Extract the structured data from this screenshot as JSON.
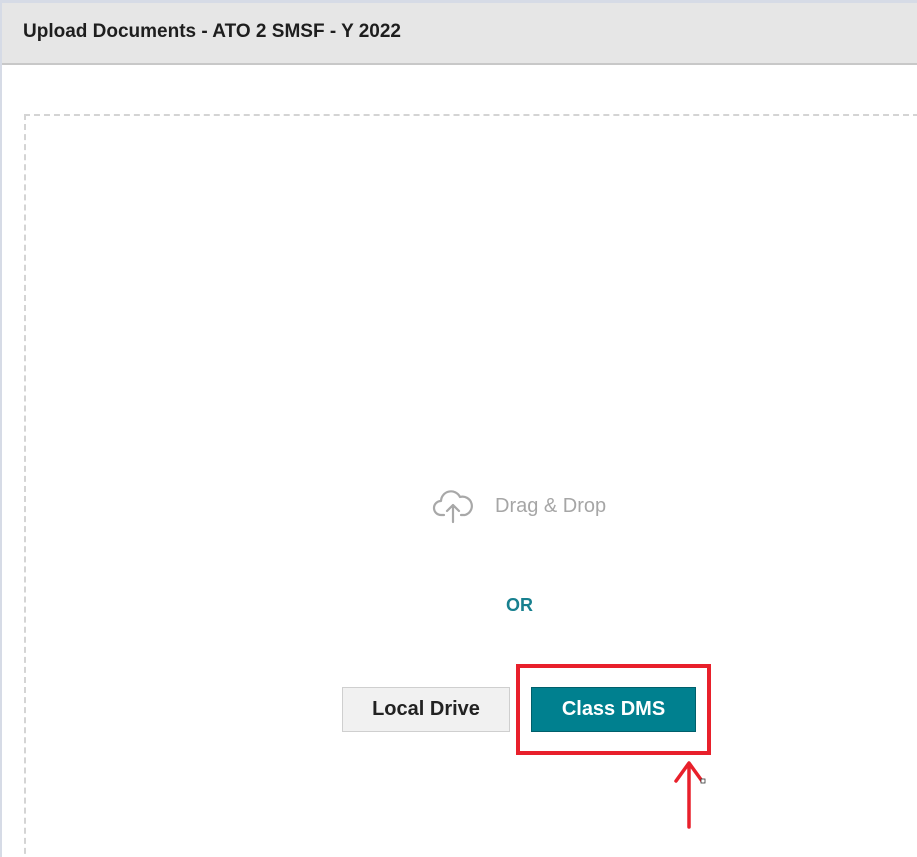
{
  "header": {
    "title": "Upload Documents - ATO 2 SMSF - Y 2022"
  },
  "drop_zone": {
    "icon": "cloud-upload-icon",
    "label": "Drag & Drop",
    "separator": "OR"
  },
  "buttons": {
    "local_drive": "Local Drive",
    "class_dms": "Class DMS"
  },
  "annotation": {
    "highlight_color": "#e8202b",
    "arrow_icon": "arrow-up-icon"
  },
  "colors": {
    "accent": "#00808f",
    "header_bg": "#e6e6e6"
  }
}
